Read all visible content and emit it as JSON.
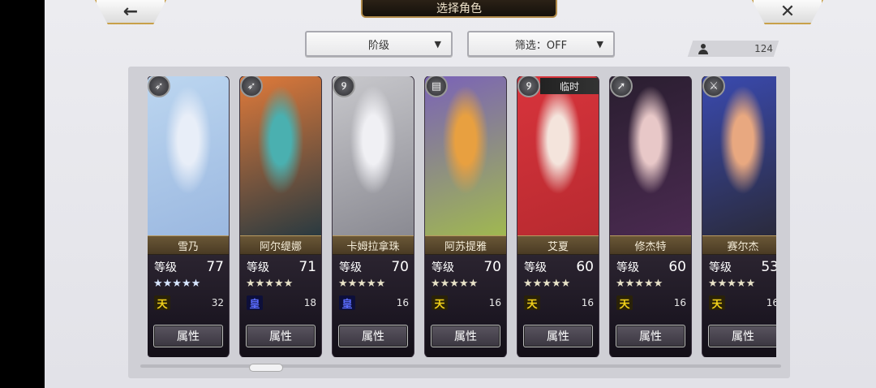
{
  "header": {
    "title": "选择角色",
    "back_icon": "←",
    "close_icon": "✕"
  },
  "filters": {
    "rank_label": "阶级",
    "filter_label": "筛选：OFF",
    "arrow": "▼"
  },
  "roster_count": "124",
  "colors": {
    "gold_border": "#c8a04a",
    "sky_tier": "#f3d21a",
    "imperial_tier": "#5a6cff"
  },
  "level_label": "等级",
  "attr_button": "属性",
  "characters": [
    {
      "name": "雪乃",
      "level": "77",
      "stars": "★★★★★",
      "star_style": "blue",
      "tier": "天",
      "tier_type": "sky",
      "count": "32",
      "class_icon": "bow-icon",
      "class_glyph": "➶",
      "tag": "",
      "art": [
        "#bcd6f0",
        "#e8eef8",
        "#9bb8e0"
      ]
    },
    {
      "name": "阿尔缇娜",
      "level": "71",
      "stars": "★★★★★",
      "star_style": "",
      "tier": "皇",
      "tier_type": "imperial",
      "count": "18",
      "class_icon": "bow-icon",
      "class_glyph": "➶",
      "tag": "",
      "art": [
        "#e07a3a",
        "#4ab0b0",
        "#2a3a40"
      ]
    },
    {
      "name": "卡姆拉拿珠",
      "level": "70",
      "stars": "★★★★★",
      "star_style": "",
      "tier": "皇",
      "tier_type": "imperial",
      "count": "16",
      "class_icon": "magic-icon",
      "class_glyph": "୨",
      "tag": "",
      "art": [
        "#c8c8cc",
        "#f0f0f4",
        "#8a8a92"
      ]
    },
    {
      "name": "阿苏提雅",
      "level": "70",
      "stars": "★★★★★",
      "star_style": "",
      "tier": "天",
      "tier_type": "sky",
      "count": "16",
      "class_icon": "shield-icon",
      "class_glyph": "▤",
      "tag": "",
      "art": [
        "#7a62b8",
        "#e8a040",
        "#a0b850"
      ]
    },
    {
      "name": "艾夏",
      "level": "60",
      "stars": "★★★★★",
      "star_style": "",
      "tier": "天",
      "tier_type": "sky",
      "count": "16",
      "class_icon": "magic-icon",
      "class_glyph": "୨",
      "tag": "临时",
      "art": [
        "#d8343c",
        "#f4e4dc",
        "#b82a30"
      ]
    },
    {
      "name": "修杰特",
      "level": "60",
      "stars": "★★★★★",
      "star_style": "",
      "tier": "天",
      "tier_type": "sky",
      "count": "16",
      "class_icon": "spear-icon",
      "class_glyph": "➚",
      "tag": "",
      "art": [
        "#2a1e30",
        "#e8c8c8",
        "#4a2a50"
      ]
    },
    {
      "name": "赛尔杰",
      "level": "53",
      "stars": "★★★★★",
      "star_style": "",
      "tier": "天",
      "tier_type": "sky",
      "count": "16",
      "class_icon": "sword-icon",
      "class_glyph": "⚔",
      "tag": "",
      "art": [
        "#3a4ab0",
        "#e8a880",
        "#2a2a3a"
      ]
    }
  ]
}
